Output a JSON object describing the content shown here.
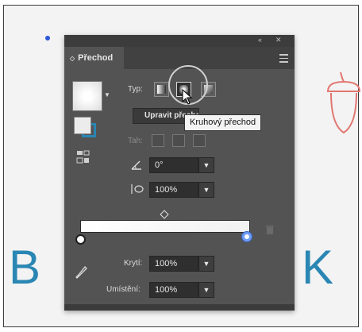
{
  "window": {
    "collapse_label": "«",
    "close_label": "✕"
  },
  "panel": {
    "tab_title": "Přechod",
    "type_label": "Typ:",
    "edit_button_label": "Upravit přechod",
    "tooltip": "Kruhový přechod",
    "stroke_label": "Tah:",
    "angle_value": "0°",
    "aspect_value": "100%",
    "opacity_label": "Krytí:",
    "opacity_value": "100%",
    "location_label": "Umístění:",
    "location_value": "100%",
    "selected_type": "radial"
  },
  "canvas": {
    "letter_left": "B",
    "letter_right": "K"
  },
  "colors": {
    "accent": "#2a86b3",
    "panel_bg": "#535353",
    "stop_highlight": "#6f9cf3",
    "acorn": "#e27670"
  },
  "icons": [
    "menu-icon",
    "angle-icon",
    "aspect-ratio-icon",
    "eyedropper-icon",
    "trash-icon",
    "reverse-gradient-icon"
  ]
}
